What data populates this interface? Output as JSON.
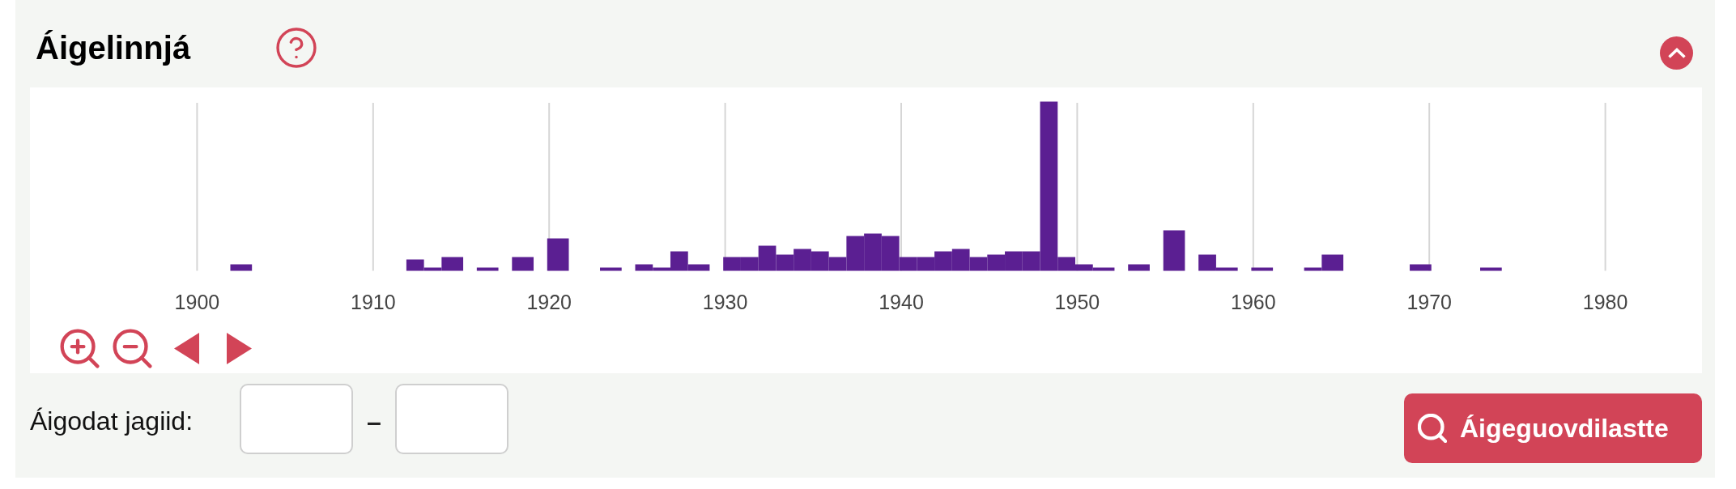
{
  "section": {
    "title": "Áigelinnjá",
    "expanded": true
  },
  "timeline": {
    "tick_labels": [
      "1900",
      "1910",
      "1920",
      "1930",
      "1940",
      "1950",
      "1960",
      "1970",
      "1980"
    ]
  },
  "date_range": {
    "label": "Áigodat jagiid:",
    "separator": "–"
  },
  "search_button": {
    "label": "Áigeguovdilastte"
  }
}
